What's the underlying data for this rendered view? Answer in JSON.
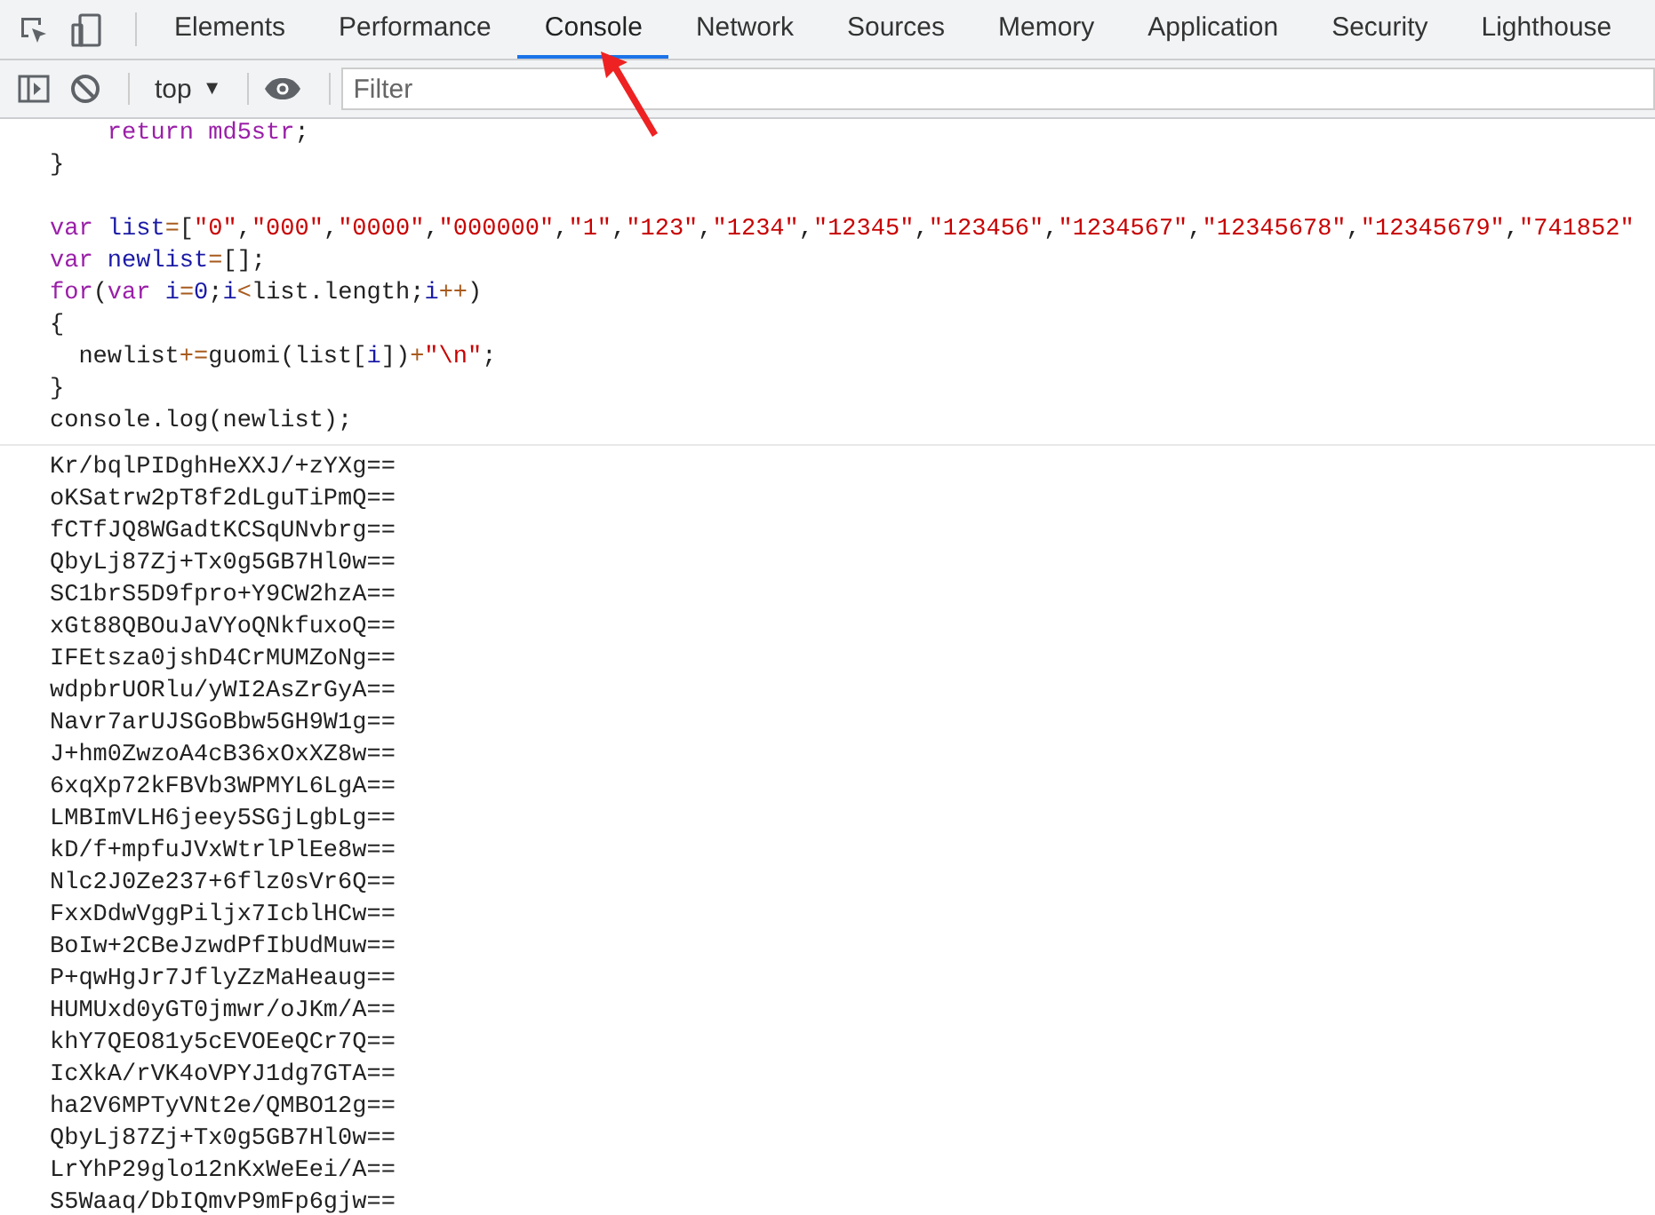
{
  "tabs": [
    {
      "label": "Elements",
      "selected": false
    },
    {
      "label": "Performance",
      "selected": false
    },
    {
      "label": "Console",
      "selected": true
    },
    {
      "label": "Network",
      "selected": false
    },
    {
      "label": "Sources",
      "selected": false
    },
    {
      "label": "Memory",
      "selected": false
    },
    {
      "label": "Application",
      "selected": false
    },
    {
      "label": "Security",
      "selected": false
    },
    {
      "label": "Lighthouse",
      "selected": false
    }
  ],
  "toolbar": {
    "context": "top",
    "context_caret": "▼",
    "filter": {
      "placeholder": "Filter"
    }
  },
  "code_lines": [
    {
      "kind": "code",
      "tokens": [
        {
          "kind": "keyword",
          "text": "    return"
        },
        {
          "kind": "keyword",
          "text": " md5str"
        },
        {
          "kind": "plain",
          "text": ";"
        }
      ]
    },
    {
      "kind": "code",
      "tokens": [
        {
          "kind": "plain",
          "text": "}"
        }
      ]
    },
    {
      "kind": "blank"
    },
    {
      "kind": "code",
      "tokens": [
        {
          "kind": "keyword",
          "text": "var "
        },
        {
          "kind": "variable",
          "text": "list"
        },
        {
          "kind": "operator",
          "text": "="
        },
        {
          "kind": "plain",
          "text": "["
        },
        {
          "kind": "string",
          "text": "\"0\""
        },
        {
          "kind": "plain",
          "text": ","
        },
        {
          "kind": "string",
          "text": "\"000\""
        },
        {
          "kind": "plain",
          "text": ","
        },
        {
          "kind": "string",
          "text": "\"0000\""
        },
        {
          "kind": "plain",
          "text": ","
        },
        {
          "kind": "string",
          "text": "\"000000\""
        },
        {
          "kind": "plain",
          "text": ","
        },
        {
          "kind": "string",
          "text": "\"1\""
        },
        {
          "kind": "plain",
          "text": ","
        },
        {
          "kind": "string",
          "text": "\"123\""
        },
        {
          "kind": "plain",
          "text": ","
        },
        {
          "kind": "string",
          "text": "\"1234\""
        },
        {
          "kind": "plain",
          "text": ","
        },
        {
          "kind": "string",
          "text": "\"12345\""
        },
        {
          "kind": "plain",
          "text": ","
        },
        {
          "kind": "string",
          "text": "\"123456\""
        },
        {
          "kind": "plain",
          "text": ","
        },
        {
          "kind": "string",
          "text": "\"1234567\""
        },
        {
          "kind": "plain",
          "text": ","
        },
        {
          "kind": "string",
          "text": "\"12345678\""
        },
        {
          "kind": "plain",
          "text": ","
        },
        {
          "kind": "string",
          "text": "\"12345679\""
        },
        {
          "kind": "plain",
          "text": ","
        },
        {
          "kind": "string",
          "text": "\"741852\""
        }
      ]
    },
    {
      "kind": "code",
      "tokens": [
        {
          "kind": "keyword",
          "text": "var "
        },
        {
          "kind": "variable",
          "text": "newlist"
        },
        {
          "kind": "operator",
          "text": "="
        },
        {
          "kind": "plain",
          "text": "[];"
        }
      ]
    },
    {
      "kind": "code",
      "tokens": [
        {
          "kind": "keyword",
          "text": "for"
        },
        {
          "kind": "plain",
          "text": "("
        },
        {
          "kind": "keyword",
          "text": "var "
        },
        {
          "kind": "variable",
          "text": "i"
        },
        {
          "kind": "operator",
          "text": "="
        },
        {
          "kind": "number",
          "text": "0"
        },
        {
          "kind": "plain",
          "text": ";"
        },
        {
          "kind": "variable",
          "text": "i"
        },
        {
          "kind": "operator",
          "text": "<"
        },
        {
          "kind": "plain",
          "text": "list.length;"
        },
        {
          "kind": "variable",
          "text": "i"
        },
        {
          "kind": "operator",
          "text": "++"
        },
        {
          "kind": "plain",
          "text": ")"
        }
      ]
    },
    {
      "kind": "code",
      "tokens": [
        {
          "kind": "plain",
          "text": "{"
        }
      ]
    },
    {
      "kind": "code",
      "tokens": [
        {
          "kind": "plain",
          "text": "  newlist"
        },
        {
          "kind": "operator",
          "text": "+="
        },
        {
          "kind": "plain",
          "text": "guomi(list["
        },
        {
          "kind": "variable",
          "text": "i"
        },
        {
          "kind": "plain",
          "text": "])"
        },
        {
          "kind": "operator",
          "text": "+"
        },
        {
          "kind": "string",
          "text": "\"\\n\""
        },
        {
          "kind": "plain",
          "text": ";"
        }
      ]
    },
    {
      "kind": "code",
      "tokens": [
        {
          "kind": "plain",
          "text": "}"
        }
      ]
    },
    {
      "kind": "code",
      "tokens": [
        {
          "kind": "plain",
          "text": "console.log(newlist);"
        }
      ]
    }
  ],
  "output_lines": [
    "Kr/bqlPIDghHeXXJ/+zYXg==",
    "oKSatrw2pT8f2dLguTiPmQ==",
    "fCTfJQ8WGadtKCSqUNvbrg==",
    "QbyLj87Zj+Tx0g5GB7Hl0w==",
    "SC1brS5D9fpro+Y9CW2hzA==",
    "xGt88QBOuJaVYoQNkfuxoQ==",
    "IFEtsza0jshD4CrMUMZoNg==",
    "wdpbrUORlu/yWI2AsZrGyA==",
    "Navr7arUJSGoBbw5GH9W1g==",
    "J+hm0ZwzoA4cB36xOxXZ8w==",
    "6xqXp72kFBVb3WPMYL6LgA==",
    "LMBImVLH6jeey5SGjLgbLg==",
    "kD/f+mpfuJVxWtrlPlEe8w==",
    "Nlc2J0Ze237+6flz0sVr6Q==",
    "FxxDdwVggPiljx7IcblHCw==",
    "BoIw+2CBeJzwdPfIbUdMuw==",
    "P+qwHgJr7JflyZzMaHeaug==",
    "HUMUxd0yGT0jmwr/oJKm/A==",
    "khY7QEO81y5cEVOEeQCr7Q==",
    "IcXkA/rVK4oVPYJ1dg7GTA==",
    "ha2V6MPTyVNt2e/QMBO12g==",
    "QbyLj87Zj+Tx0g5GB7Hl0w==",
    "LrYhP29glo12nKxWeEei/A==",
    "S5Waaq/DbIQmvP9mFp6gjw=="
  ]
}
